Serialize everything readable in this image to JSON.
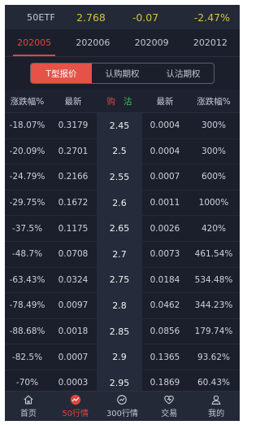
{
  "header": {
    "symbol": "50ETF",
    "price": "2.768",
    "change": "-0.07",
    "change_pct": "-2.47%"
  },
  "months": [
    {
      "label": "202005",
      "active": true
    },
    {
      "label": "202006",
      "active": false
    },
    {
      "label": "202009",
      "active": false
    },
    {
      "label": "202012",
      "active": false
    }
  ],
  "segment": {
    "items": [
      "T型报价",
      "认购期权",
      "认沽期权"
    ],
    "active_index": 0
  },
  "table": {
    "headers": {
      "call_change_pct": "涨跌幅%",
      "call_latest": "最新",
      "buy": "购",
      "sell": "沽",
      "put_latest": "最新",
      "put_change_pct": "涨跌幅%"
    },
    "rows": [
      {
        "call_pct": "-18.07%",
        "call_last": "0.3179",
        "strike": "2.45",
        "put_last": "0.0004",
        "put_pct": "300%"
      },
      {
        "call_pct": "-20.09%",
        "call_last": "0.2701",
        "strike": "2.5",
        "put_last": "0.0004",
        "put_pct": "300%"
      },
      {
        "call_pct": "-24.79%",
        "call_last": "0.2166",
        "strike": "2.55",
        "put_last": "0.0007",
        "put_pct": "600%"
      },
      {
        "call_pct": "-29.75%",
        "call_last": "0.1672",
        "strike": "2.6",
        "put_last": "0.0011",
        "put_pct": "1000%"
      },
      {
        "call_pct": "-37.5%",
        "call_last": "0.1175",
        "strike": "2.65",
        "put_last": "0.0026",
        "put_pct": "420%"
      },
      {
        "call_pct": "-48.7%",
        "call_last": "0.0708",
        "strike": "2.7",
        "put_last": "0.0073",
        "put_pct": "461.54%"
      },
      {
        "call_pct": "-63.43%",
        "call_last": "0.0324",
        "strike": "2.75",
        "put_last": "0.0184",
        "put_pct": "534.48%"
      },
      {
        "call_pct": "-78.49%",
        "call_last": "0.0097",
        "strike": "2.8",
        "put_last": "0.0462",
        "put_pct": "344.23%"
      },
      {
        "call_pct": "-88.68%",
        "call_last": "0.0018",
        "strike": "2.85",
        "put_last": "0.0856",
        "put_pct": "179.74%"
      },
      {
        "call_pct": "-82.5%",
        "call_last": "0.0007",
        "strike": "2.9",
        "put_last": "0.1365",
        "put_pct": "93.62%"
      },
      {
        "call_pct": "-70%",
        "call_last": "0.0003",
        "strike": "2.95",
        "put_last": "0.1869",
        "put_pct": "60.43%"
      }
    ]
  },
  "tabbar": [
    {
      "label": "首页",
      "icon": "home-icon",
      "active": false
    },
    {
      "label": "50行情",
      "icon": "trend-icon",
      "active": true
    },
    {
      "label": "300行情",
      "icon": "gauge-icon",
      "active": false
    },
    {
      "label": "交易",
      "icon": "heart-icon",
      "active": false
    },
    {
      "label": "我的",
      "icon": "user-icon",
      "active": false
    }
  ],
  "colors": {
    "accent": "#e0453f",
    "price_yellow": "#d8c23a",
    "sell_green": "#3cc060",
    "background": "#1b1f2c"
  }
}
